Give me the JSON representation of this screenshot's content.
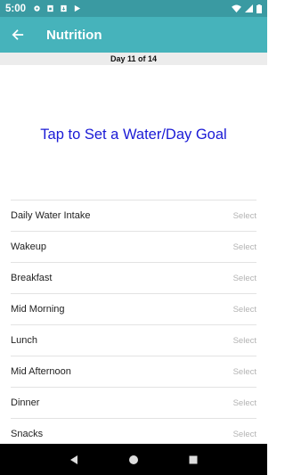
{
  "status_bar": {
    "time": "5:00",
    "icons_left": [
      "gear-icon",
      "sim-icon",
      "download-icon",
      "play-icon"
    ],
    "icons_right": [
      "wifi-icon",
      "signal-icon",
      "battery-icon"
    ]
  },
  "app_bar": {
    "title": "Nutrition",
    "back_icon": "arrow-left-icon"
  },
  "day_bar": {
    "label": "Day 11 of 14"
  },
  "goal": {
    "label": "Tap to Set a Water/Day Goal"
  },
  "rows": [
    {
      "label": "Daily Water Intake",
      "value": "Select"
    },
    {
      "label": "Wakeup",
      "value": "Select"
    },
    {
      "label": "Breakfast",
      "value": "Select"
    },
    {
      "label": "Mid Morning",
      "value": "Select"
    },
    {
      "label": "Lunch",
      "value": "Select"
    },
    {
      "label": "Mid Afternoon",
      "value": "Select"
    },
    {
      "label": "Dinner",
      "value": "Select"
    },
    {
      "label": "Snacks",
      "value": "Select"
    }
  ],
  "colors": {
    "status_bar": "#3a9aa2",
    "app_bar": "#46b3bb",
    "goal_text": "#1a1ad6"
  },
  "nav_bar": {
    "buttons": [
      "back-triangle-icon",
      "home-circle-icon",
      "recents-square-icon"
    ]
  }
}
